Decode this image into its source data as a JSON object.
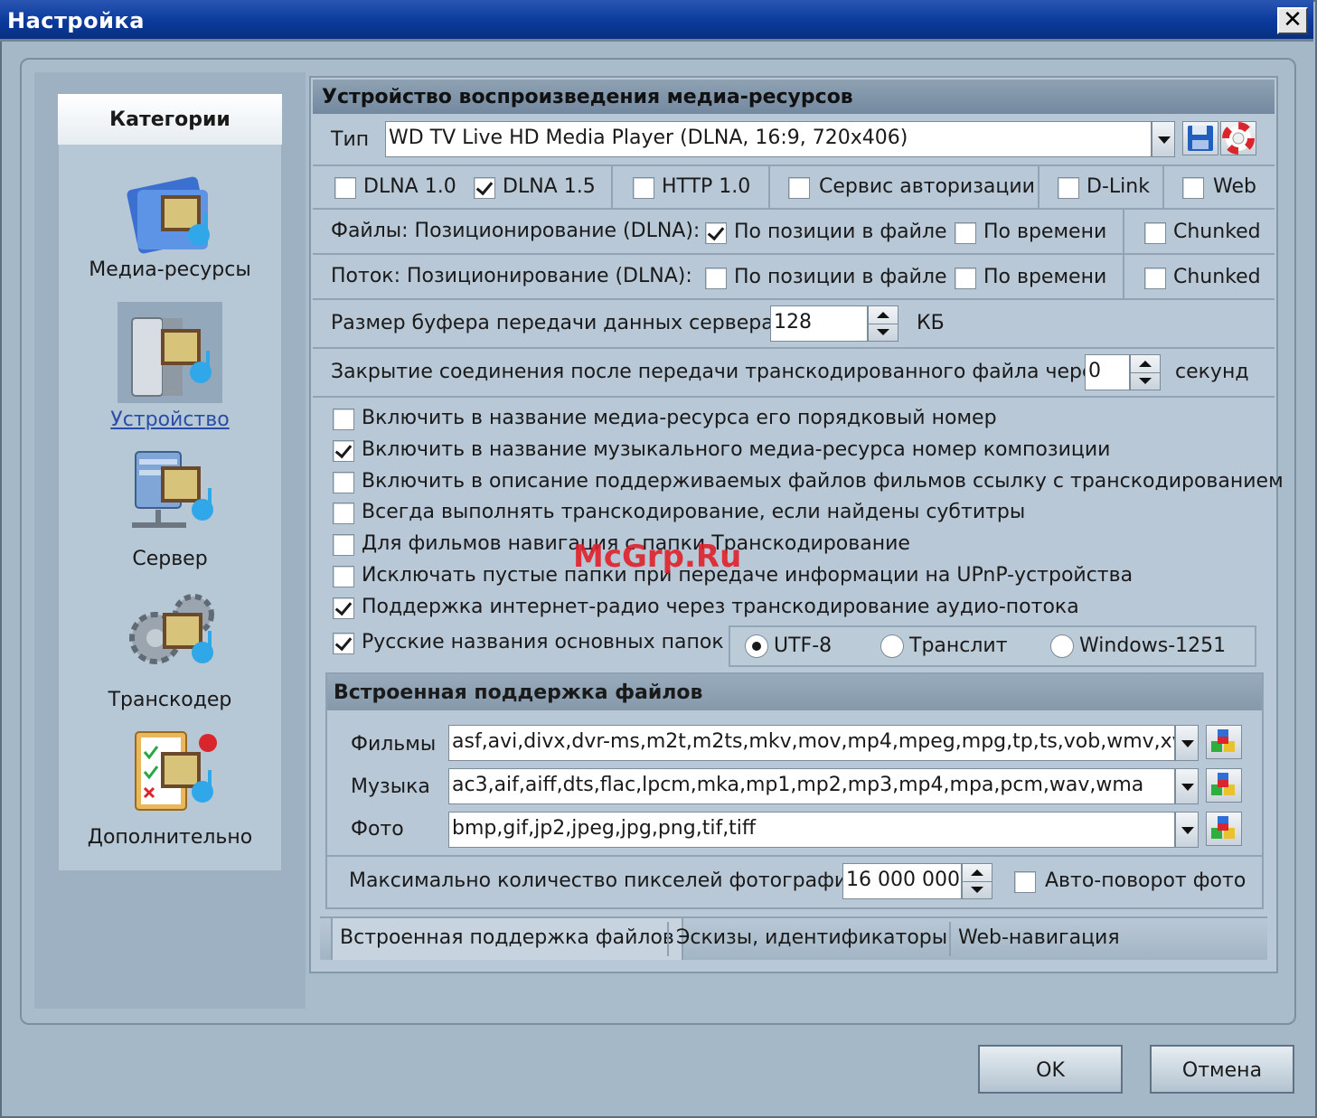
{
  "window": {
    "title": "Настройка",
    "close_glyph": "✕"
  },
  "sidebar": {
    "header": "Категории",
    "items": [
      {
        "label": "Медиа-ресурсы",
        "icon": "media-folder-icon"
      },
      {
        "label": "Устройство",
        "icon": "device-icon",
        "selected": true
      },
      {
        "label": "Сервер",
        "icon": "server-icon"
      },
      {
        "label": "Транскодер",
        "icon": "transcoder-gears-icon"
      },
      {
        "label": "Дополнительно",
        "icon": "additional-checklist-icon"
      }
    ]
  },
  "device": {
    "section_title": "Устройство воспроизведения медиа-ресурсов",
    "type_label": "Тип",
    "type_value": "WD TV Live HD Media Player (DLNA, 16:9, 720x406)",
    "protocols": [
      {
        "label": "DLNA 1.0",
        "checked": false
      },
      {
        "label": "DLNA 1.5",
        "checked": true
      },
      {
        "label": "HTTP 1.0",
        "checked": false
      },
      {
        "label": "Сервис авторизации",
        "checked": false
      },
      {
        "label": "D-Link",
        "checked": false
      },
      {
        "label": "Web",
        "checked": false
      }
    ],
    "files_seek": {
      "label": "Файлы: Позиционирование (DLNA):",
      "by_position": {
        "label": "По позиции в файле",
        "checked": true
      },
      "by_time": {
        "label": "По времени",
        "checked": false
      },
      "chunked": {
        "label": "Chunked",
        "checked": false
      }
    },
    "stream_seek": {
      "label": "Поток: Позиционирование (DLNA):",
      "by_position": {
        "label": "По позиции в файле",
        "checked": false
      },
      "by_time": {
        "label": "По времени",
        "checked": false
      },
      "chunked": {
        "label": "Chunked",
        "checked": false
      }
    },
    "buffer": {
      "label": "Размер буфера передачи данных сервера",
      "value": "128",
      "unit": "КБ"
    },
    "close_conn": {
      "label": "Закрытие соединения после передачи транскодированного файла через",
      "value": "0",
      "unit": "секунд"
    },
    "options": [
      {
        "label": "Включить в название медиа-ресурса его порядковый номер",
        "checked": false
      },
      {
        "label": "Включить в название музыкального медиа-ресурса номер композиции",
        "checked": true
      },
      {
        "label": "Включить в описание поддерживаемых файлов фильмов ссылку с транскодированием",
        "checked": false
      },
      {
        "label": "Всегда выполнять транскодирование, если найдены субтитры",
        "checked": false
      },
      {
        "label": "Для фильмов навигация с папки Транскодирование",
        "checked": false
      },
      {
        "label": "Исключать пустые папки при передаче информации на  UPnP-устройства",
        "checked": false
      },
      {
        "label": "Поддержка интернет-радио через транскодирование аудио-потока",
        "checked": true
      },
      {
        "label": "Русские названия основных папок",
        "checked": true
      }
    ],
    "encoding": [
      {
        "label": "UTF-8",
        "checked": true
      },
      {
        "label": "Транслит",
        "checked": false
      },
      {
        "label": "Windows-1251",
        "checked": false
      }
    ]
  },
  "builtin": {
    "title": "Встроенная поддержка файлов",
    "films_label": "Фильмы",
    "films_value": "asf,avi,divx,dvr-ms,m2t,m2ts,mkv,mov,mp4,mpeg,mpg,tp,ts,vob,wmv,xvid",
    "music_label": "Музыка",
    "music_value": "ac3,aif,aiff,dts,flac,lpcm,mka,mp1,mp2,mp3,mp4,mpa,pcm,wav,wma",
    "photo_label": "Фото",
    "photo_value": "bmp,gif,jp2,jpeg,jpg,png,tif,tiff",
    "max_pixels_label": "Максимально количество пикселей фотографий",
    "max_pixels_value": "16 000 000",
    "autorotate": {
      "label": "Авто-поворот фото",
      "checked": false
    }
  },
  "tabs": [
    {
      "label": "Встроенная поддержка файлов",
      "active": true
    },
    {
      "label": "Эскизы, идентификаторы",
      "active": false
    },
    {
      "label": "Web-навигация",
      "active": false
    }
  ],
  "buttons": {
    "ok": "OK",
    "cancel": "Отмена"
  },
  "watermark": "McGrp.Ru"
}
